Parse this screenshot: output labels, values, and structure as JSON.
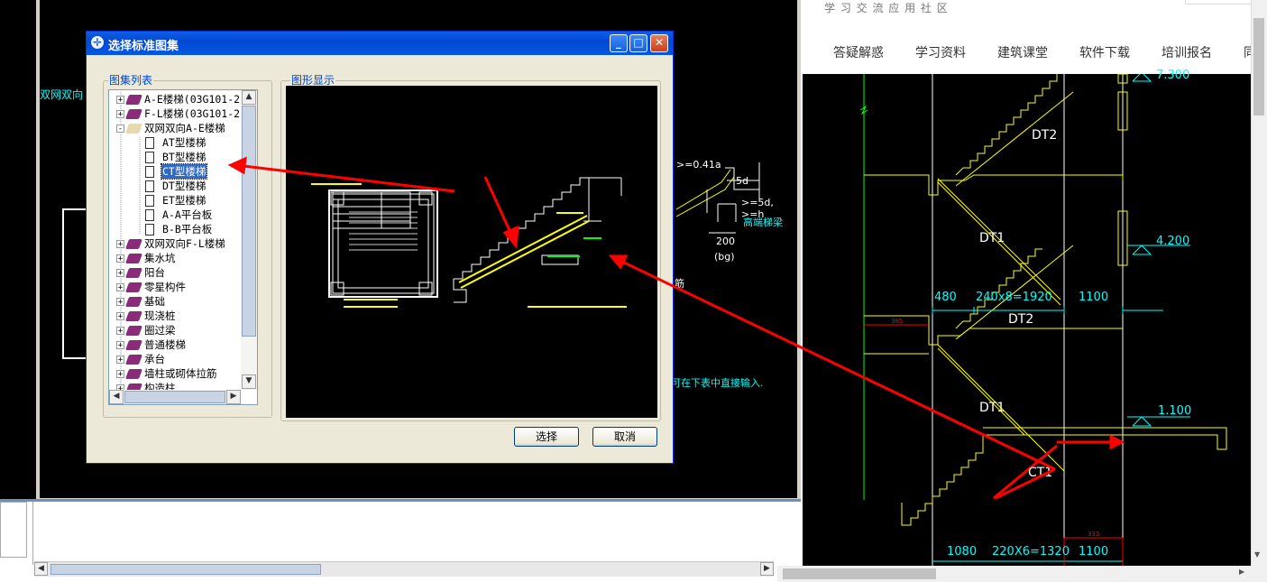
{
  "dialog": {
    "title": "选择标准图集",
    "tree_group_label": "图集列表",
    "preview_group_label": "图形显示",
    "select_button": "选择",
    "cancel_button": "取消",
    "tree": [
      {
        "label": "A-E楼梯(03G101-2)",
        "level": 0,
        "type": "book",
        "expander": "+"
      },
      {
        "label": "F-L楼梯(03G101-2)",
        "level": 0,
        "type": "book",
        "expander": "+"
      },
      {
        "label": "双网双向A-E楼梯",
        "level": 0,
        "type": "book-open",
        "expander": "-"
      },
      {
        "label": "AT型楼梯",
        "level": 1,
        "type": "doc"
      },
      {
        "label": "BT型楼梯",
        "level": 1,
        "type": "doc"
      },
      {
        "label": "CT型楼梯",
        "level": 1,
        "type": "doc",
        "selected": true
      },
      {
        "label": "DT型楼梯",
        "level": 1,
        "type": "doc"
      },
      {
        "label": "ET型楼梯",
        "level": 1,
        "type": "doc"
      },
      {
        "label": "A-A平台板",
        "level": 1,
        "type": "doc"
      },
      {
        "label": "B-B平台板",
        "level": 1,
        "type": "doc"
      },
      {
        "label": "双网双向F-L楼梯",
        "level": 0,
        "type": "book",
        "expander": "+"
      },
      {
        "label": "集水坑",
        "level": 0,
        "type": "book",
        "expander": "+"
      },
      {
        "label": "阳台",
        "level": 0,
        "type": "book",
        "expander": "+"
      },
      {
        "label": "零星构件",
        "level": 0,
        "type": "book",
        "expander": "+"
      },
      {
        "label": "基础",
        "level": 0,
        "type": "book",
        "expander": "+"
      },
      {
        "label": "现浇桩",
        "level": 0,
        "type": "book",
        "expander": "+"
      },
      {
        "label": "圈过梁",
        "level": 0,
        "type": "book",
        "expander": "+"
      },
      {
        "label": "普通楼梯",
        "level": 0,
        "type": "book",
        "expander": "+"
      },
      {
        "label": "承台",
        "level": 0,
        "type": "book",
        "expander": "+"
      },
      {
        "label": "墙柱或砌体拉筋",
        "level": 0,
        "type": "book",
        "expander": "+"
      },
      {
        "label": "构造柱",
        "level": 0,
        "type": "book",
        "expander": "+"
      }
    ]
  },
  "left_cad": {
    "side_label": "双网双向",
    "anchor_text": ">=0.41a",
    "dim_5d": "5d",
    "dim_5d_h": ">=5d, >=h",
    "high_beam": "高端梯梁",
    "dim_200": "200",
    "bg_label": "(bg)",
    "jin": "筋",
    "hint": "可在下表中直接输入."
  },
  "browser": {
    "community": "学 习 交 流 应 用 社 区",
    "nav": [
      "答疑解惑",
      "学习资料",
      "建筑课堂",
      "软件下载",
      "培训报名",
      "同"
    ]
  },
  "right_cad": {
    "labels": [
      "DT2",
      "DT1",
      "DT2",
      "DT1",
      "CT1"
    ],
    "elevations": [
      "4.200",
      "1.100"
    ],
    "top_elev": "7.300",
    "dims_mid": [
      "480",
      "240x8=1920",
      "1100"
    ],
    "dims_bottom": [
      "1080",
      "220X6=1320",
      "1100"
    ],
    "small_red_1": "385",
    "small_red_2": "333"
  },
  "colors": {
    "cad_bg": "#000000",
    "cad_line": "#ffffff",
    "cad_yellow": "#ffff00",
    "cad_cyan": "#00ffff",
    "annotation_red": "#ff0000",
    "xp_title": "#0348d1"
  }
}
